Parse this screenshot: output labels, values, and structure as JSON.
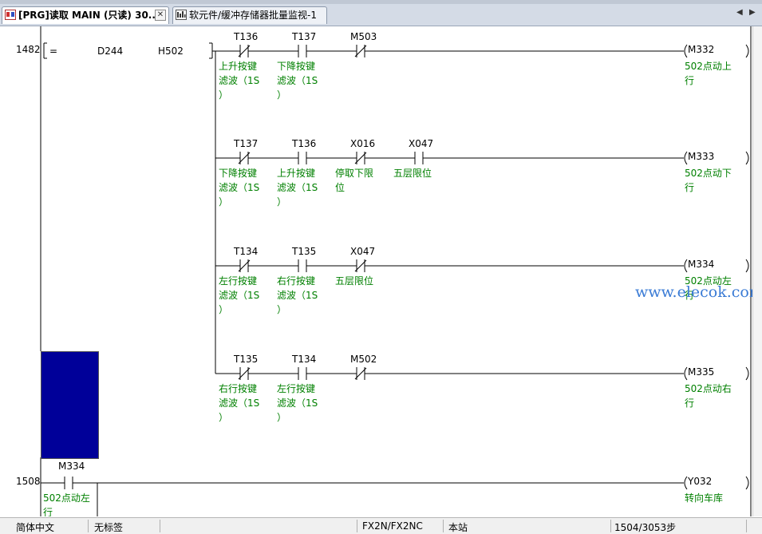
{
  "tabs": [
    {
      "label": "[PRG]读取 MAIN (只读) 30...",
      "close": "✕"
    },
    {
      "label": "软元件/缓冲存储器批量监视-1"
    }
  ],
  "nav": {
    "prev": "◀",
    "next": "▶"
  },
  "ladder": {
    "step_1482": "1482",
    "step_1508": "1508",
    "compare_op": "=",
    "compare_s1": "D244",
    "compare_s2": "H502",
    "rungs": [
      {
        "contacts": [
          {
            "device": "T136",
            "type": "NC",
            "comment": "上升按键\n滤波（1S\n）"
          },
          {
            "device": "T137",
            "type": "NO",
            "comment": "下降按键\n滤波（1S\n）"
          },
          {
            "device": "M503",
            "type": "NC",
            "comment": ""
          }
        ],
        "coil": {
          "device": "M332",
          "comment": "502点动上\n行"
        }
      },
      {
        "contacts": [
          {
            "device": "T137",
            "type": "NC",
            "comment": "下降按键\n滤波（1S\n）"
          },
          {
            "device": "T136",
            "type": "NO",
            "comment": "上升按键\n滤波（1S\n）"
          },
          {
            "device": "X016",
            "type": "NC",
            "comment": "停取下限\n位"
          },
          {
            "device": "X047",
            "type": "NO",
            "comment": "五层限位"
          }
        ],
        "coil": {
          "device": "M333",
          "comment": "502点动下\n行"
        }
      },
      {
        "contacts": [
          {
            "device": "T134",
            "type": "NC",
            "comment": "左行按键\n滤波（1S\n）"
          },
          {
            "device": "T135",
            "type": "NO",
            "comment": "右行按键\n滤波（1S\n）"
          },
          {
            "device": "X047",
            "type": "NC",
            "comment": "五层限位"
          }
        ],
        "coil": {
          "device": "M334",
          "comment": "502点动左\n行"
        }
      },
      {
        "contacts": [
          {
            "device": "T135",
            "type": "NC",
            "comment": "右行按键\n滤波（1S\n）"
          },
          {
            "device": "T134",
            "type": "NO",
            "comment": "左行按键\n滤波（1S\n）"
          },
          {
            "device": "M502",
            "type": "NC",
            "comment": ""
          }
        ],
        "coil": {
          "device": "M335",
          "comment": "502点动右\n行"
        }
      }
    ],
    "bottom_rung": {
      "contact": {
        "device": "M334",
        "comment": "502点动左\n行"
      },
      "coil": {
        "device": "Y032",
        "comment": "转向车库"
      }
    }
  },
  "watermark": "www.elecok.com",
  "status": {
    "language": "简体中文",
    "label": "无标签",
    "plc": "FX2N/FX2NC",
    "station": "本站",
    "steps": "1504/3053步"
  },
  "colors": {
    "wire": "#000000",
    "comment": "#008000",
    "cursor": "#000099"
  }
}
